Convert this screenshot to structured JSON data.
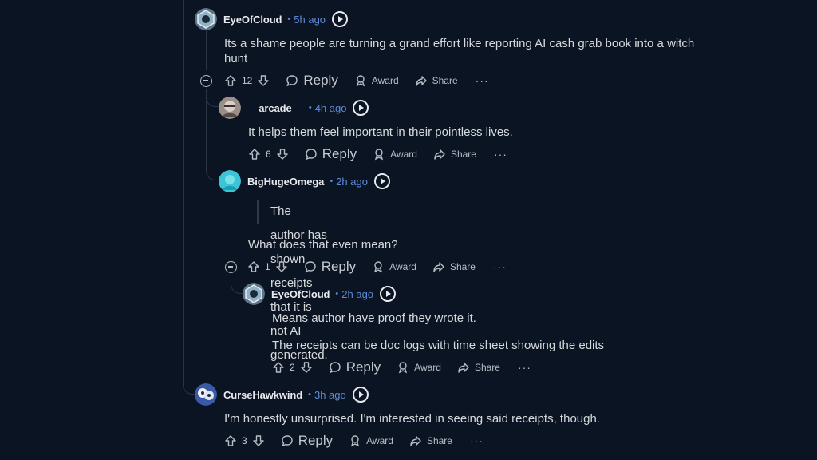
{
  "theme": {
    "background": "#0b1423",
    "time_color": "#5c8bd6"
  },
  "comments": [
    {
      "author": "EyeOfCloud",
      "time": "5h ago",
      "lines": [
        "Its a shame people are turning a grand effort like reporting AI cash grab book into a witch",
        "hunt"
      ],
      "score": "12",
      "reply": "Reply",
      "award": "Award",
      "share": "Share",
      "more": "···"
    },
    {
      "author": "__arcade__",
      "time": "4h ago",
      "lines": [
        "It helps them feel important in their pointless lives."
      ],
      "score": "6",
      "reply": "Reply",
      "award": "Award",
      "share": "Share",
      "more": "···"
    },
    {
      "author": "BigHugeOmega",
      "time": "2h ago",
      "quote": "The author has shown receipts that it is not AI generated.",
      "lines": [
        "What does that even mean?"
      ],
      "score": "1",
      "reply": "Reply",
      "award": "Award",
      "share": "Share",
      "more": "···"
    },
    {
      "author": "EyeOfCloud",
      "time": "2h ago",
      "lines": [
        "Means author have proof they wrote it.",
        "The receipts can be doc logs with time sheet showing the edits"
      ],
      "score": "2",
      "reply": "Reply",
      "award": "Award",
      "share": "Share",
      "more": "···"
    },
    {
      "author": "CurseHawkwind",
      "time": "3h ago",
      "lines": [
        "I'm honestly unsurprised. I'm interested in seeing said receipts, though."
      ],
      "score": "3",
      "reply": "Reply",
      "award": "Award",
      "share": "Share",
      "more": "···"
    }
  ]
}
